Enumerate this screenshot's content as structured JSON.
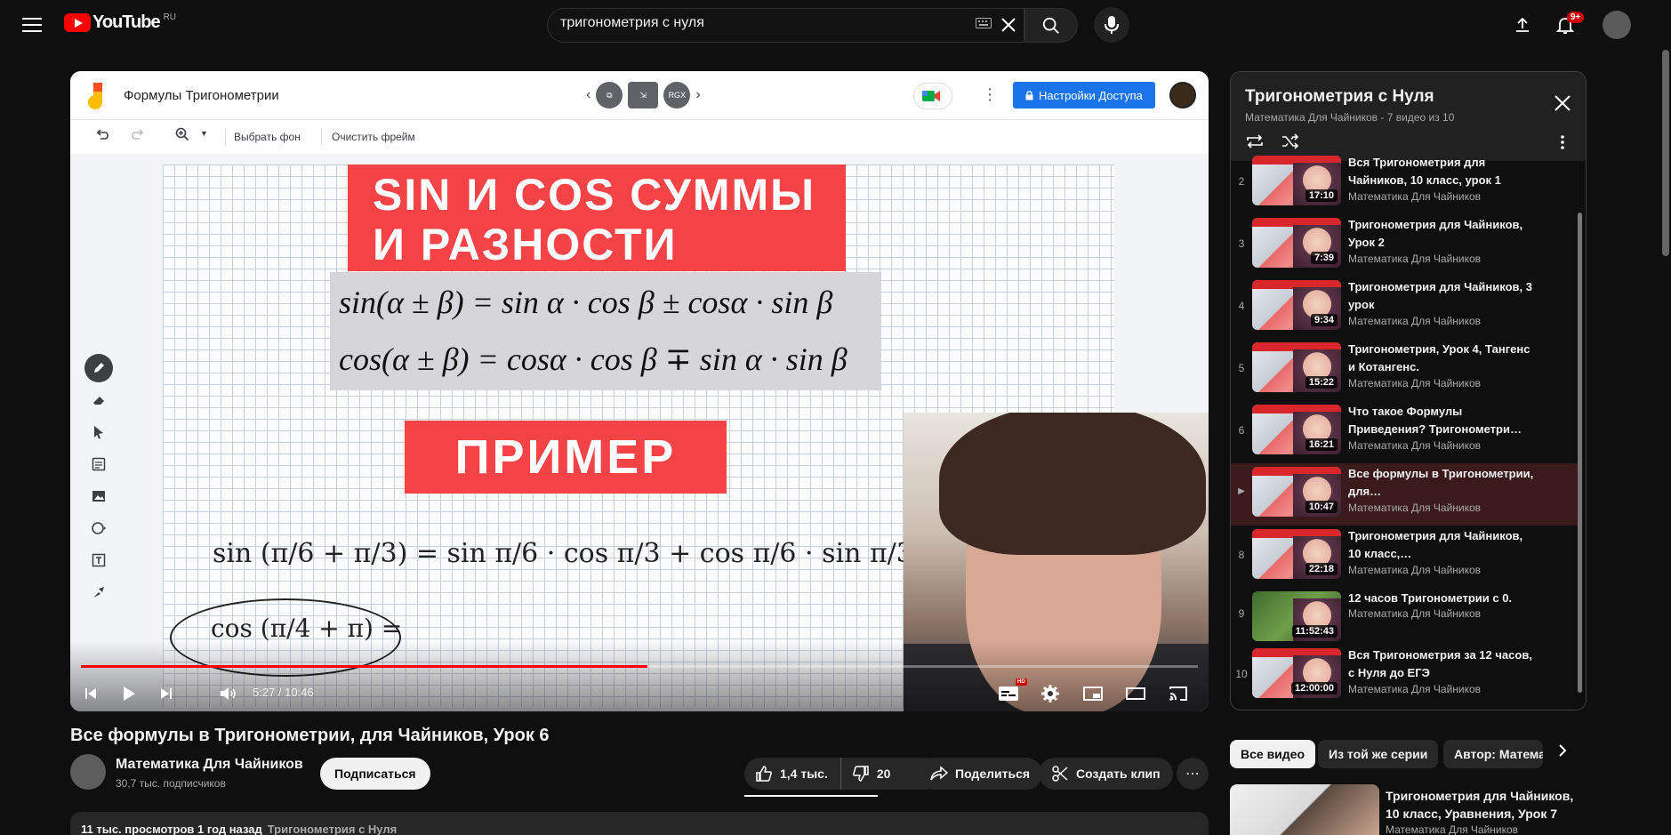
{
  "header": {
    "logo_text": "YouTube",
    "region": "RU",
    "search_value": "тригонометрия с нуля",
    "notifications": "9+"
  },
  "player": {
    "jam": {
      "doc_title": "Формулы Тригонометрии",
      "center_badge": "RGX",
      "share_label": "Настройки Доступа",
      "bg_label": "Выбрать фон",
      "clear_label": "Очистить фрейм"
    },
    "slide": {
      "title_line1": "SIN И COS СУММЫ",
      "title_line2": "И РАЗНОСТИ",
      "formula1": "sin(α ± β) = sin α · cos β ± cosα · sin β",
      "formula2": "cos(α ± β) = cosα · cos β ∓ sin α · sin β",
      "example": "ПРИМЕР",
      "hw_line1": "sin (π/6 + π/3) = sin π/6 · cos π/3 + cos π/6 · sin π/3 =",
      "hw_line2": "cos (π/4 + π) ="
    },
    "time": "5:27 / 10:46",
    "progress": 0.507,
    "hd": "HD"
  },
  "video": {
    "title": "Все формулы в Тригонометрии, для Чайников, Урок 6",
    "channel": "Математика Для Чайников",
    "subscribers": "30,7 тыс. подписчиков",
    "subscribe": "Подписаться",
    "likes": "1,4 тыс.",
    "dislikes": "20",
    "share": "Поделиться",
    "clip": "Создать клип",
    "meta": "11 тыс. просмотров  1 год назад",
    "meta_tag": "Тригонометрия с Нуля"
  },
  "playlist": {
    "title": "Тригонометрия с Нуля",
    "subtitle": "Математика Для Чайников - 7 видео из 10",
    "items": [
      {
        "index": "2",
        "title": "Вся Тригонометрия для Чайников, 10 класс, урок 1",
        "channel": "Математика Для Чайников",
        "duration": "17:10"
      },
      {
        "index": "3",
        "title": "Тригонометрия для Чайников, Урок 2",
        "channel": "Математика Для Чайников",
        "duration": "7:39"
      },
      {
        "index": "4",
        "title": "Тригонометрия для Чайников, 3 урок",
        "channel": "Математика Для Чайников",
        "duration": "9:34"
      },
      {
        "index": "5",
        "title": "Тригонометрия, Урок 4, Тангенс и Котангенс.",
        "channel": "Математика Для Чайников",
        "duration": "15:22"
      },
      {
        "index": "6",
        "title": "Что такое Формулы Приведения? Тригонометри…",
        "channel": "Математика Для Чайников",
        "duration": "16:21"
      },
      {
        "index": "▶",
        "title": "Все формулы в Тригонометрии, для…",
        "channel": "Математика Для Чайников",
        "duration": "10:47"
      },
      {
        "index": "8",
        "title": "Тригонометрия для Чайников, 10 класс,…",
        "channel": "Математика Для Чайников",
        "duration": "22:18"
      },
      {
        "index": "9",
        "title": "12 часов Тригонометрии с 0.",
        "channel": "Математика Для Чайников",
        "duration": "11:52:43"
      },
      {
        "index": "10",
        "title": "Вся Тригонометрия за 12 часов, с Нуля до ЕГЭ",
        "channel": "Математика Для Чайников",
        "duration": "12:00:00"
      }
    ]
  },
  "chips": {
    "all": "Все видео",
    "series": "Из той же серии",
    "author": "Автор: Математика Для Чайников"
  },
  "recommendation": {
    "title": "Тригонометрия для Чайников, 10 класс, Уравнения, Урок 7",
    "channel": "Математика Для Чайников"
  }
}
